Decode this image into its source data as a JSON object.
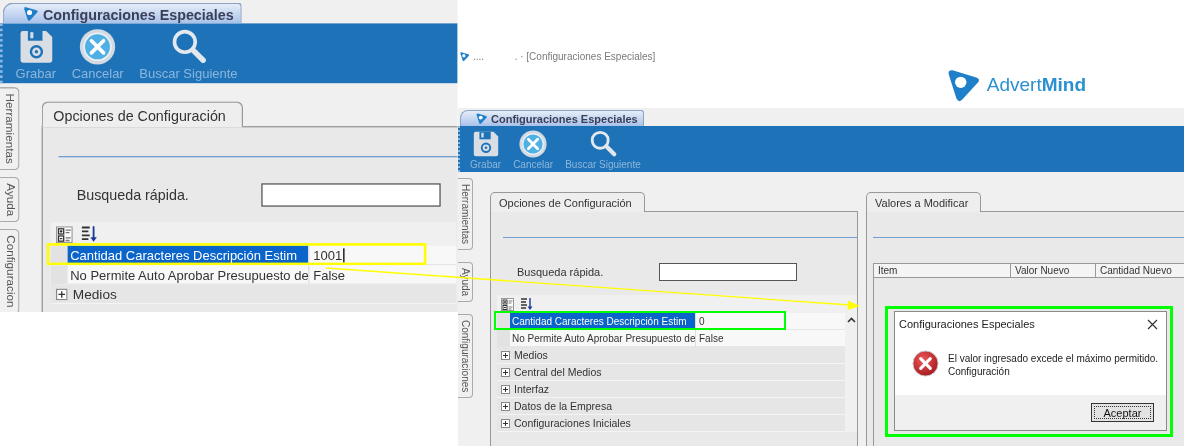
{
  "screens": [
    {
      "kind": "zoomed",
      "tab_title": "Configuraciones Especiales",
      "toolbar": [
        {
          "kind": "save",
          "label": "Grabar"
        },
        {
          "kind": "cancel",
          "label": "Cancelar"
        },
        {
          "kind": "search",
          "label": "Buscar Siguiente"
        }
      ],
      "side_tabs": [
        "Herramientas",
        "Ayuda",
        "Configuracion"
      ],
      "color": "#ffff00",
      "options_panel": {
        "title": "Opciones de Configuración",
        "search_label": "Busqueda rápida.",
        "rows": [
          {
            "name": "Cantidad Caracteres Descripción Estim",
            "value": "1001",
            "selected": true,
            "editing": true,
            "annotated": true
          },
          {
            "name": "No Permite Auto Aprobar Presupuesto de",
            "value": "False",
            "selected": false,
            "editing": false,
            "annotated": false
          }
        ],
        "groups": [
          {
            "label": "Medios",
            "expanded": false
          }
        ]
      }
    },
    {
      "kind": "full",
      "app_title": "....           . · [Configuraciones Especiales]",
      "brand": "Advert**Mind**",
      "tab_title": "Configuraciones Especiales",
      "toolbar": [
        {
          "kind": "save",
          "label": "Grabar"
        },
        {
          "kind": "cancel",
          "label": "Cancelar"
        },
        {
          "kind": "search",
          "label": "Buscar Siguiente"
        }
      ],
      "side_tabs": [
        "Herramientas",
        "Ayuda",
        "Configuraciones"
      ],
      "color": "#00ff00",
      "options_panel": {
        "title": "Opciones de Configuración",
        "search_label": "Busqueda rápida.",
        "rows": [
          {
            "name": "Cantidad Caracteres Descripción Estim",
            "value": "0",
            "selected": true,
            "editing": false,
            "annotated": true
          },
          {
            "name": "No Permite Auto Aprobar Presupuesto de",
            "value": "False",
            "selected": false,
            "editing": false,
            "annotated": false
          }
        ],
        "groups": [
          {
            "label": "Medios",
            "expanded": false
          },
          {
            "label": "Central del Medios",
            "expanded": false
          },
          {
            "label": "Interfaz",
            "expanded": false
          },
          {
            "label": "Datos de la Empresa",
            "expanded": false
          },
          {
            "label": "Configuraciones Iniciales",
            "expanded": false
          }
        ]
      },
      "values_panel": {
        "title": "Valores a Modificar",
        "columns": [
          "Item",
          "Valor Nuevo",
          "Cantidad Nuevo"
        ]
      },
      "dialog": {
        "title": "Configuraciones Especiales",
        "message": "El valor ingresado excede el máximo permitido.",
        "detail": "Configuración",
        "button": "Aceptar",
        "annotated": true
      }
    }
  ]
}
